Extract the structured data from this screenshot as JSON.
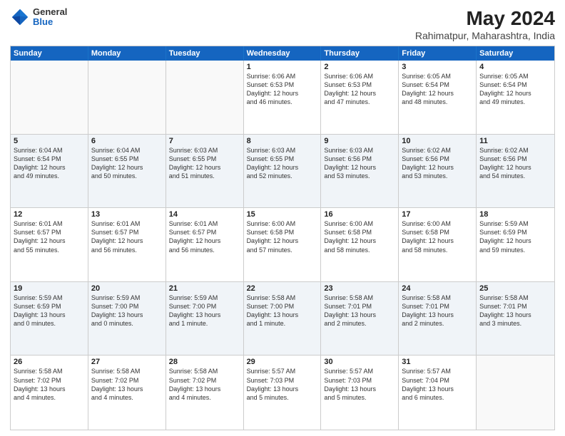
{
  "header": {
    "logo": {
      "general": "General",
      "blue": "Blue"
    },
    "title": "May 2024",
    "subtitle": "Rahimatpur, Maharashtra, India"
  },
  "weekdays": [
    "Sunday",
    "Monday",
    "Tuesday",
    "Wednesday",
    "Thursday",
    "Friday",
    "Saturday"
  ],
  "weeks": [
    [
      {
        "day": "",
        "info": ""
      },
      {
        "day": "",
        "info": ""
      },
      {
        "day": "",
        "info": ""
      },
      {
        "day": "1",
        "info": "Sunrise: 6:06 AM\nSunset: 6:53 PM\nDaylight: 12 hours\nand 46 minutes."
      },
      {
        "day": "2",
        "info": "Sunrise: 6:06 AM\nSunset: 6:53 PM\nDaylight: 12 hours\nand 47 minutes."
      },
      {
        "day": "3",
        "info": "Sunrise: 6:05 AM\nSunset: 6:54 PM\nDaylight: 12 hours\nand 48 minutes."
      },
      {
        "day": "4",
        "info": "Sunrise: 6:05 AM\nSunset: 6:54 PM\nDaylight: 12 hours\nand 49 minutes."
      }
    ],
    [
      {
        "day": "5",
        "info": "Sunrise: 6:04 AM\nSunset: 6:54 PM\nDaylight: 12 hours\nand 49 minutes."
      },
      {
        "day": "6",
        "info": "Sunrise: 6:04 AM\nSunset: 6:55 PM\nDaylight: 12 hours\nand 50 minutes."
      },
      {
        "day": "7",
        "info": "Sunrise: 6:03 AM\nSunset: 6:55 PM\nDaylight: 12 hours\nand 51 minutes."
      },
      {
        "day": "8",
        "info": "Sunrise: 6:03 AM\nSunset: 6:55 PM\nDaylight: 12 hours\nand 52 minutes."
      },
      {
        "day": "9",
        "info": "Sunrise: 6:03 AM\nSunset: 6:56 PM\nDaylight: 12 hours\nand 53 minutes."
      },
      {
        "day": "10",
        "info": "Sunrise: 6:02 AM\nSunset: 6:56 PM\nDaylight: 12 hours\nand 53 minutes."
      },
      {
        "day": "11",
        "info": "Sunrise: 6:02 AM\nSunset: 6:56 PM\nDaylight: 12 hours\nand 54 minutes."
      }
    ],
    [
      {
        "day": "12",
        "info": "Sunrise: 6:01 AM\nSunset: 6:57 PM\nDaylight: 12 hours\nand 55 minutes."
      },
      {
        "day": "13",
        "info": "Sunrise: 6:01 AM\nSunset: 6:57 PM\nDaylight: 12 hours\nand 56 minutes."
      },
      {
        "day": "14",
        "info": "Sunrise: 6:01 AM\nSunset: 6:57 PM\nDaylight: 12 hours\nand 56 minutes."
      },
      {
        "day": "15",
        "info": "Sunrise: 6:00 AM\nSunset: 6:58 PM\nDaylight: 12 hours\nand 57 minutes."
      },
      {
        "day": "16",
        "info": "Sunrise: 6:00 AM\nSunset: 6:58 PM\nDaylight: 12 hours\nand 58 minutes."
      },
      {
        "day": "17",
        "info": "Sunrise: 6:00 AM\nSunset: 6:58 PM\nDaylight: 12 hours\nand 58 minutes."
      },
      {
        "day": "18",
        "info": "Sunrise: 5:59 AM\nSunset: 6:59 PM\nDaylight: 12 hours\nand 59 minutes."
      }
    ],
    [
      {
        "day": "19",
        "info": "Sunrise: 5:59 AM\nSunset: 6:59 PM\nDaylight: 13 hours\nand 0 minutes."
      },
      {
        "day": "20",
        "info": "Sunrise: 5:59 AM\nSunset: 7:00 PM\nDaylight: 13 hours\nand 0 minutes."
      },
      {
        "day": "21",
        "info": "Sunrise: 5:59 AM\nSunset: 7:00 PM\nDaylight: 13 hours\nand 1 minute."
      },
      {
        "day": "22",
        "info": "Sunrise: 5:58 AM\nSunset: 7:00 PM\nDaylight: 13 hours\nand 1 minute."
      },
      {
        "day": "23",
        "info": "Sunrise: 5:58 AM\nSunset: 7:01 PM\nDaylight: 13 hours\nand 2 minutes."
      },
      {
        "day": "24",
        "info": "Sunrise: 5:58 AM\nSunset: 7:01 PM\nDaylight: 13 hours\nand 2 minutes."
      },
      {
        "day": "25",
        "info": "Sunrise: 5:58 AM\nSunset: 7:01 PM\nDaylight: 13 hours\nand 3 minutes."
      }
    ],
    [
      {
        "day": "26",
        "info": "Sunrise: 5:58 AM\nSunset: 7:02 PM\nDaylight: 13 hours\nand 4 minutes."
      },
      {
        "day": "27",
        "info": "Sunrise: 5:58 AM\nSunset: 7:02 PM\nDaylight: 13 hours\nand 4 minutes."
      },
      {
        "day": "28",
        "info": "Sunrise: 5:58 AM\nSunset: 7:02 PM\nDaylight: 13 hours\nand 4 minutes."
      },
      {
        "day": "29",
        "info": "Sunrise: 5:57 AM\nSunset: 7:03 PM\nDaylight: 13 hours\nand 5 minutes."
      },
      {
        "day": "30",
        "info": "Sunrise: 5:57 AM\nSunset: 7:03 PM\nDaylight: 13 hours\nand 5 minutes."
      },
      {
        "day": "31",
        "info": "Sunrise: 5:57 AM\nSunset: 7:04 PM\nDaylight: 13 hours\nand 6 minutes."
      },
      {
        "day": "",
        "info": ""
      }
    ]
  ]
}
